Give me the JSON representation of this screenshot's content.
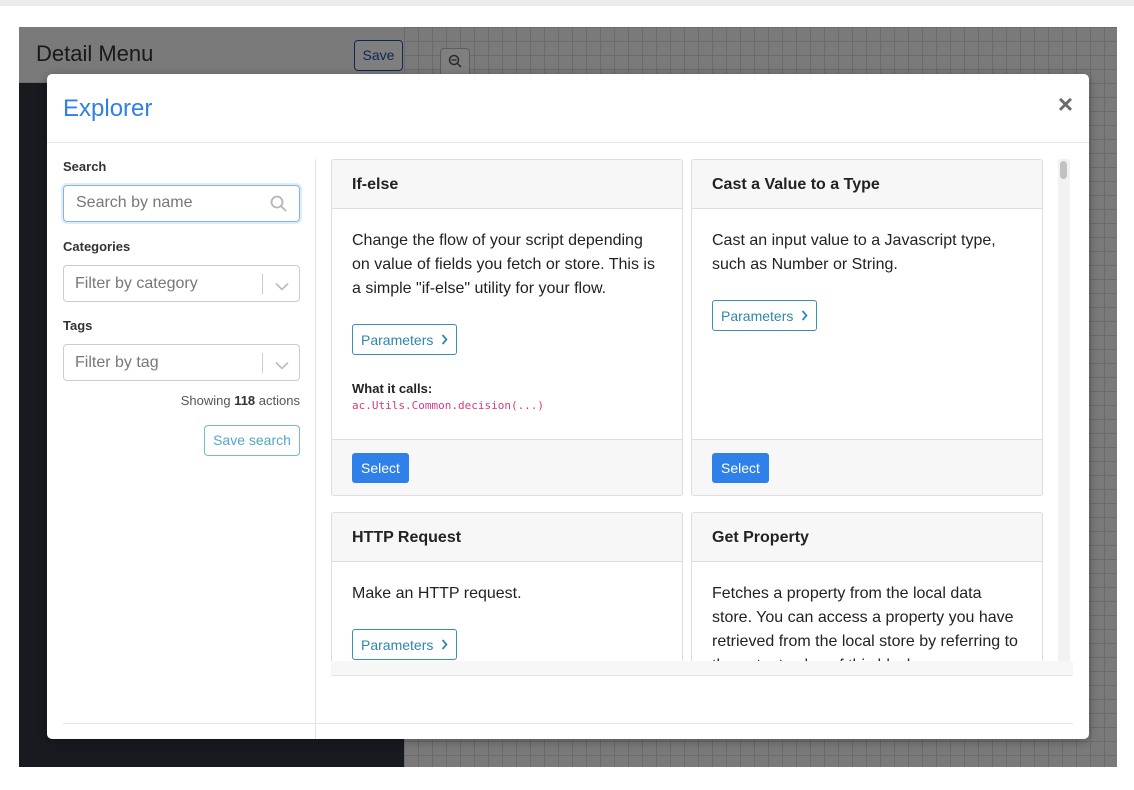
{
  "background": {
    "title": "Detail Menu",
    "save_label": "Save"
  },
  "modal": {
    "title": "Explorer",
    "close_label": "×"
  },
  "filters": {
    "search_label": "Search",
    "search_placeholder": "Search by name",
    "categories_label": "Categories",
    "categories_placeholder": "Filter by category",
    "tags_label": "Tags",
    "tags_placeholder": "Filter by tag",
    "showing_prefix": "Showing",
    "showing_count": "118",
    "showing_suffix": "actions",
    "save_search_label": "Save search"
  },
  "cards": [
    {
      "title": "If-else",
      "description": "Change the flow of your script depending on value of fields you fetch or store. This is a simple \"if-else\" utility for your flow.",
      "params_label": "Parameters",
      "calls_label": "What it calls:",
      "calls_code": "ac.Utils.Common.decision(...)",
      "select_label": "Select"
    },
    {
      "title": "Cast a Value to a Type",
      "description": "Cast an input value to a Javascript type, such as Number or String.",
      "params_label": "Parameters",
      "select_label": "Select"
    },
    {
      "title": "HTTP Request",
      "description": "Make an HTTP request.",
      "params_label": "Parameters"
    },
    {
      "title": "Get Property",
      "description": "Fetches a property from the local data store. You can access a property you have retrieved from the local store by referring to the output value of this block."
    }
  ],
  "colors": {
    "accent": "#2f80e8",
    "secondary": "#2f86b0",
    "code": "#d23c84"
  }
}
